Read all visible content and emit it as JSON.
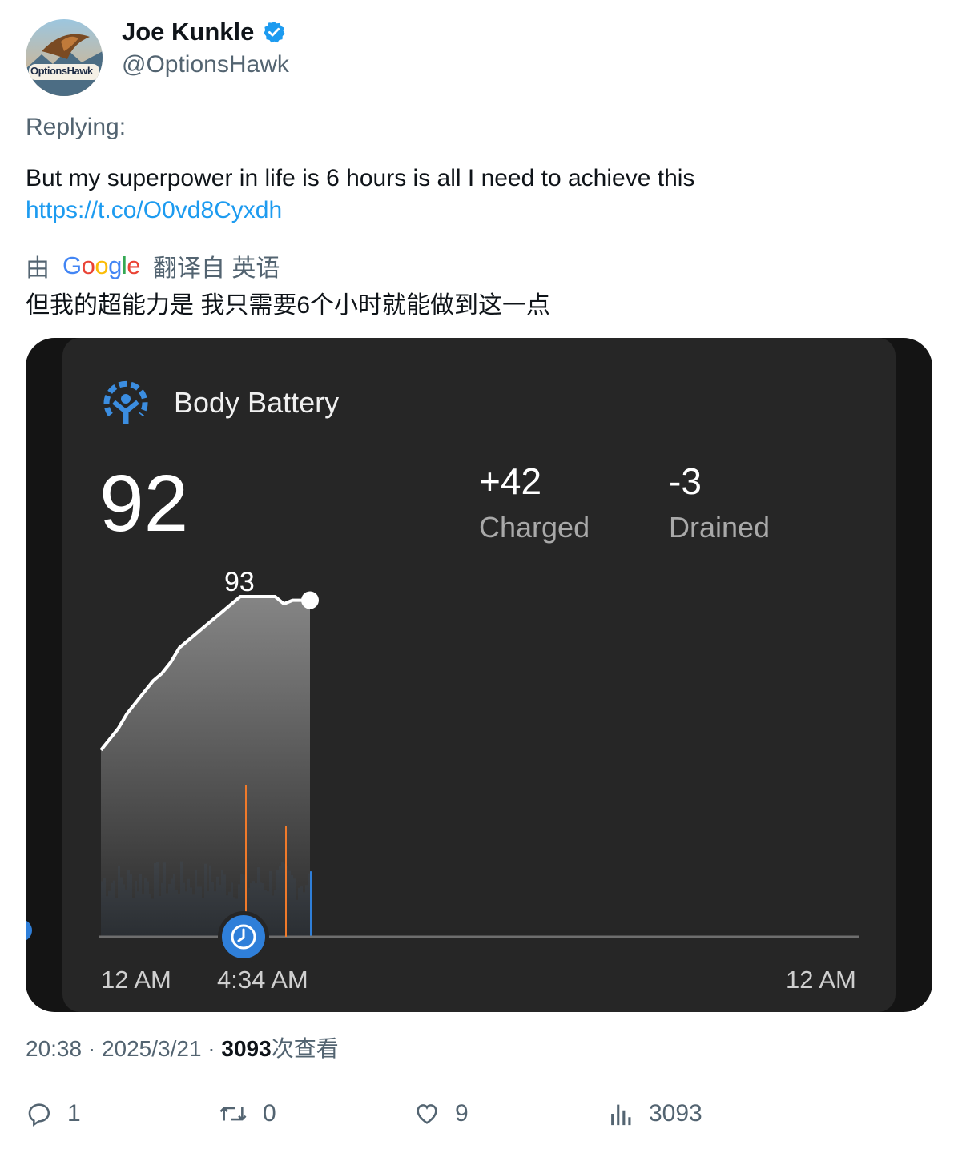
{
  "user": {
    "name": "Joe Kunkle",
    "handle": "@OptionsHawk",
    "avatar_text": "OptionsHawk"
  },
  "tweet": {
    "replying": "Replying:",
    "text": "But my superpower in life is 6 hours is all I need to achieve this",
    "link": "https://t.co/O0vd8Cyxdh"
  },
  "translation": {
    "by": "由",
    "provider": "Google",
    "from": "翻译自 英语",
    "text": "但我的超能力是 我只需要6个小时就能做到这一点"
  },
  "media": {
    "title": "Body Battery",
    "current": "92",
    "charged_value": "+42",
    "charged_label": "Charged",
    "drained_value": "-3",
    "drained_label": "Drained",
    "peak_label": "93",
    "x_labels": [
      "12 AM",
      "4:34 AM",
      "12 AM"
    ],
    "accent": "#3b8de0",
    "stress_color": "#2f7fd9",
    "activity_color": "#f07a2a"
  },
  "chart_data": {
    "type": "area",
    "series": [
      {
        "x": [
          0,
          0.25,
          0.5,
          0.75,
          1,
          1.25,
          1.5,
          1.75,
          2,
          2.25,
          2.5,
          2.75,
          3,
          3.25,
          3.5,
          3.75,
          4,
          4.25,
          4.5,
          4.75,
          5,
          5.25,
          5.5,
          5.75,
          6
        ],
        "values": [
          51,
          54,
          57,
          61,
          64,
          67,
          70,
          72,
          75,
          79,
          81,
          83,
          85,
          87,
          89,
          91,
          93,
          93,
          93,
          93,
          93,
          91,
          92,
          92,
          92
        ]
      }
    ],
    "ylim": [
      0,
      100
    ],
    "x_tick_labels": [
      "12 AM",
      "4:34 AM",
      "12 AM"
    ],
    "annotations": [
      "93"
    ]
  },
  "meta": {
    "time": "20:38 · 2025/3/21 · ",
    "views_num": "3093",
    "views_label": "次查看"
  },
  "actions": {
    "replies": "1",
    "retweets": "0",
    "likes": "9",
    "views": "3093"
  }
}
